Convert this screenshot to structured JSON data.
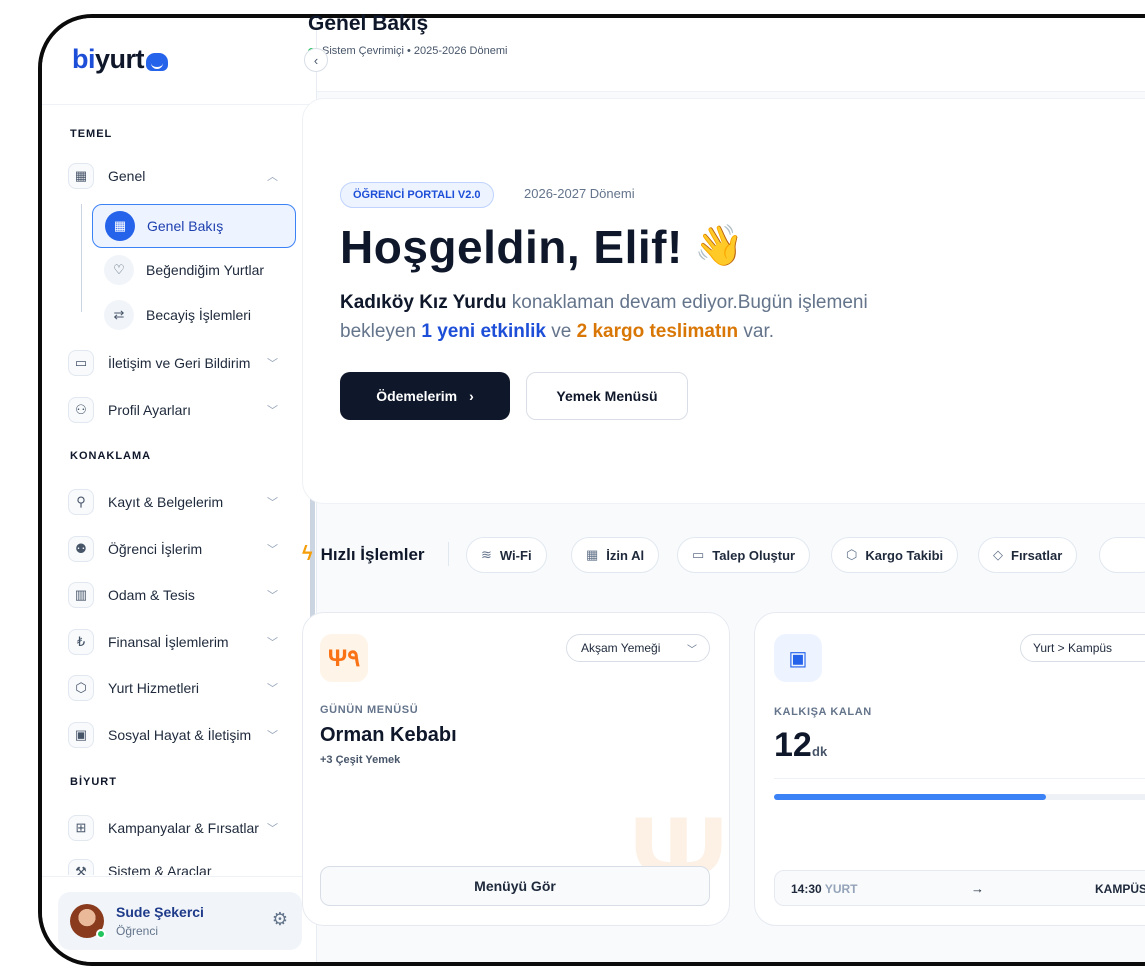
{
  "brand": {
    "logo_bi": "bi",
    "logo_yurt": "yurt"
  },
  "header": {
    "title": "Genel Bakış",
    "status": "Sistem Çevrimiçi • 2025-2026 Dönemi"
  },
  "sidebar": {
    "collapse_icon": "chevron-left-icon",
    "sections": {
      "temel": "TEMEL",
      "konaklama": "KONAKLAMA",
      "biyurt": "BİYURT"
    },
    "genel": {
      "label": "Genel",
      "icon": "grid-icon"
    },
    "sub_items": [
      {
        "label": "Genel Bakış",
        "icon": "grid-icon",
        "active": true
      },
      {
        "label": "Beğendiğim Yurtlar",
        "icon": "heart-icon"
      },
      {
        "label": "Becayiş İşlemleri",
        "icon": "swap-icon"
      }
    ],
    "items": [
      {
        "label": "İletişim ve Geri Bildirim",
        "icon": "chat-icon"
      },
      {
        "label": "Profil Ayarları",
        "icon": "user-edit-icon"
      },
      {
        "label": "Kayıt & Belgelerim",
        "icon": "user-add-icon"
      },
      {
        "label": "Öğrenci İşlerim",
        "icon": "users-icon"
      },
      {
        "label": "Odam & Tesis",
        "icon": "building-icon"
      },
      {
        "label": "Finansal İşlemlerim",
        "icon": "receipt-icon"
      },
      {
        "label": "Yurt Hizmetleri",
        "icon": "box-icon"
      },
      {
        "label": "Sosyal Hayat & İletişim",
        "icon": "wallet-icon"
      },
      {
        "label": "Kampanyalar & Fırsatlar",
        "icon": "gift-icon"
      },
      {
        "label": "Sistem & Araçlar",
        "icon": "tools-icon"
      }
    ],
    "user": {
      "name": "Sude Şekerci",
      "role": "Öğrenci"
    }
  },
  "hero": {
    "badge": "ÖĞRENCİ PORTALI V2.0",
    "period": "2026-2027 Dönemi",
    "greeting": "Hoşgeldin, Elif!",
    "wave": "👋",
    "desc_dorm": "Kadıköy Kız Yurdu",
    "desc_mid": " konaklaman devam ediyor.Bugün işlemeni bekleyen ",
    "desc_event": "1 yeni etkinlik",
    "desc_and": " ve ",
    "desc_cargo": "2 kargo teslimatın",
    "desc_end": " var.",
    "btn_primary": "Ödemelerim",
    "btn_secondary": "Yemek Menüsü"
  },
  "quick": {
    "title": "Hızlı İşlemler",
    "chips": [
      {
        "label": "Wi-Fi",
        "icon": "wifi-icon"
      },
      {
        "label": "İzin Al",
        "icon": "calendar-icon"
      },
      {
        "label": "Talep Oluştur",
        "icon": "message-icon"
      },
      {
        "label": "Kargo Takibi",
        "icon": "package-icon"
      },
      {
        "label": "Fırsatlar",
        "icon": "tag-icon"
      }
    ]
  },
  "menu_card": {
    "meal_select": "Akşam Yemeği",
    "label": "GÜNÜN MENÜSÜ",
    "dish": "Orman Kebabı",
    "extra": "+3 Çeşit Yemek",
    "button": "Menüyü Gör"
  },
  "bus_card": {
    "route": "Yurt > Kampüs",
    "label": "KALKIŞA KALAN",
    "minutes": "12",
    "unit": "dk",
    "progress": 0.68,
    "time": "14:30",
    "origin": "YURT",
    "arrow": "→",
    "dest": "KAMPÜS"
  },
  "colors": {
    "accent": "#2563eb",
    "orange": "#d97706",
    "dark": "#0f172a",
    "online": "#22c55e"
  }
}
